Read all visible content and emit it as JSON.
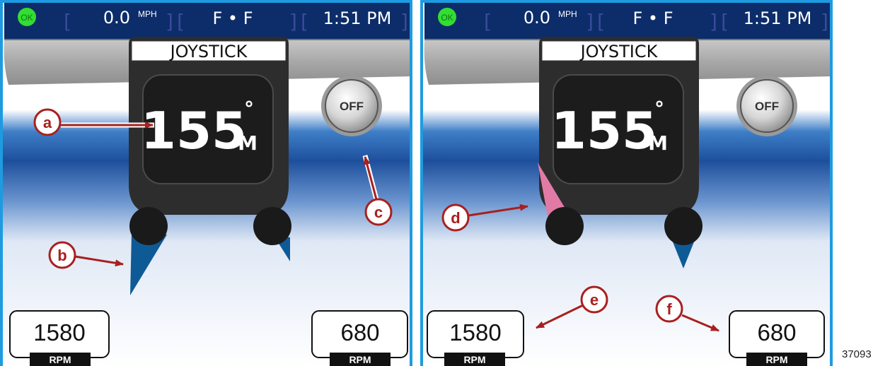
{
  "status_bar": {
    "ok_label": "OK",
    "speed": "0.0",
    "speed_unit": "MPH",
    "gear": "F • F",
    "clock": "1:51 PM"
  },
  "joystick": {
    "title": "JOYSTICK",
    "heading": "155",
    "degree_symbol": "°",
    "heading_ref": "M"
  },
  "off_button_label": "OFF",
  "panels": [
    {
      "rpm_port": "1580",
      "rpm_starboard": "680",
      "rpm_unit": "RPM"
    },
    {
      "rpm_port": "1580",
      "rpm_starboard": "680",
      "rpm_unit": "RPM"
    }
  ],
  "callouts": [
    "a",
    "b",
    "c",
    "d",
    "e",
    "f"
  ],
  "figure_number": "37093",
  "colors": {
    "frame_blue": "#1e9be0",
    "status_bar": "#0c2d6a",
    "ok_green": "#33dd33",
    "callout_red": "#a8201f",
    "thrust_blue": "#0e5a96",
    "thrust_pink": "#e27aa6",
    "display_body": "#2d2d2d"
  }
}
